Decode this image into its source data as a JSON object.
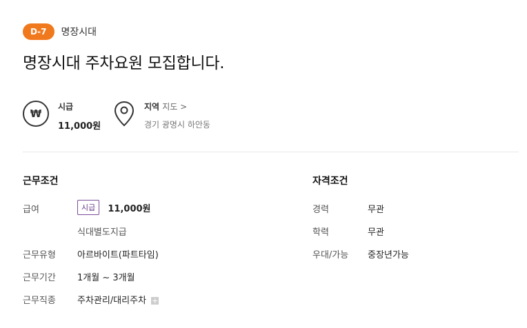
{
  "header": {
    "dday": "D-7",
    "company": "명장시대"
  },
  "title": "명장시대 주차요원 모집합니다.",
  "summary": {
    "wage": {
      "icon": "won-icon",
      "icon_glyph": "₩",
      "label": "시급",
      "value": "11,000원"
    },
    "location": {
      "icon": "map-pin-icon",
      "label": "지역",
      "map_link": "지도 >",
      "value": "경기 광명시 하안동"
    }
  },
  "work": {
    "title": "근무조건",
    "pay_label": "급여",
    "pay_type": "시급",
    "pay_amount": "11,000원",
    "pay_note": "식대별도지급",
    "type_label": "근무유형",
    "type_value": "아르바이트(파트타임)",
    "period_label": "근무기간",
    "period_value": "1개월 ~ 3개월",
    "job_label": "근무직종",
    "job_value": "주차관리/대리주차",
    "job_more": "+"
  },
  "qual": {
    "title": "자격조건",
    "career_label": "경력",
    "career_value": "무관",
    "edu_label": "학력",
    "edu_value": "무관",
    "pref_label": "우대/가능",
    "pref_value": "중장년가능"
  }
}
